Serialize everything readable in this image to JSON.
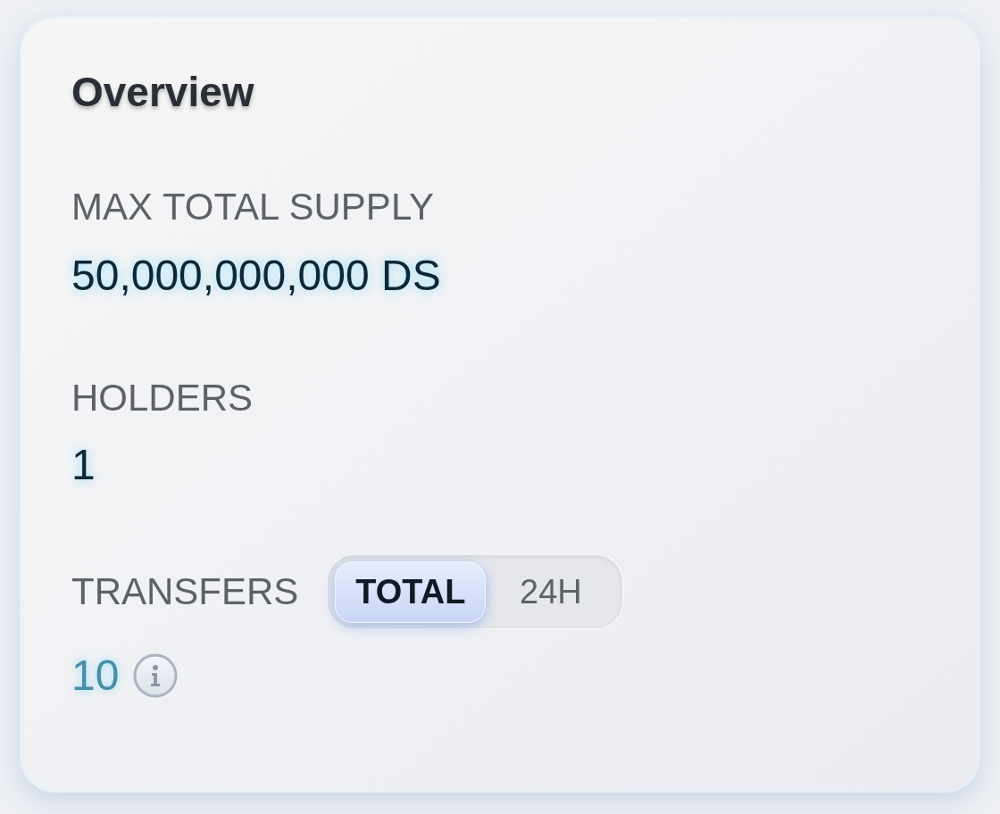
{
  "card": {
    "title": "Overview"
  },
  "stats": [
    {
      "label": "MAX TOTAL SUPPLY",
      "value": "50,000,000,000 DS"
    },
    {
      "label": "HOLDERS",
      "value": "1"
    }
  ],
  "transfers": {
    "label": "TRANSFERS",
    "tabs": [
      {
        "label": "TOTAL",
        "selected": true
      },
      {
        "label": "24H",
        "selected": false
      }
    ],
    "value": "10"
  }
}
